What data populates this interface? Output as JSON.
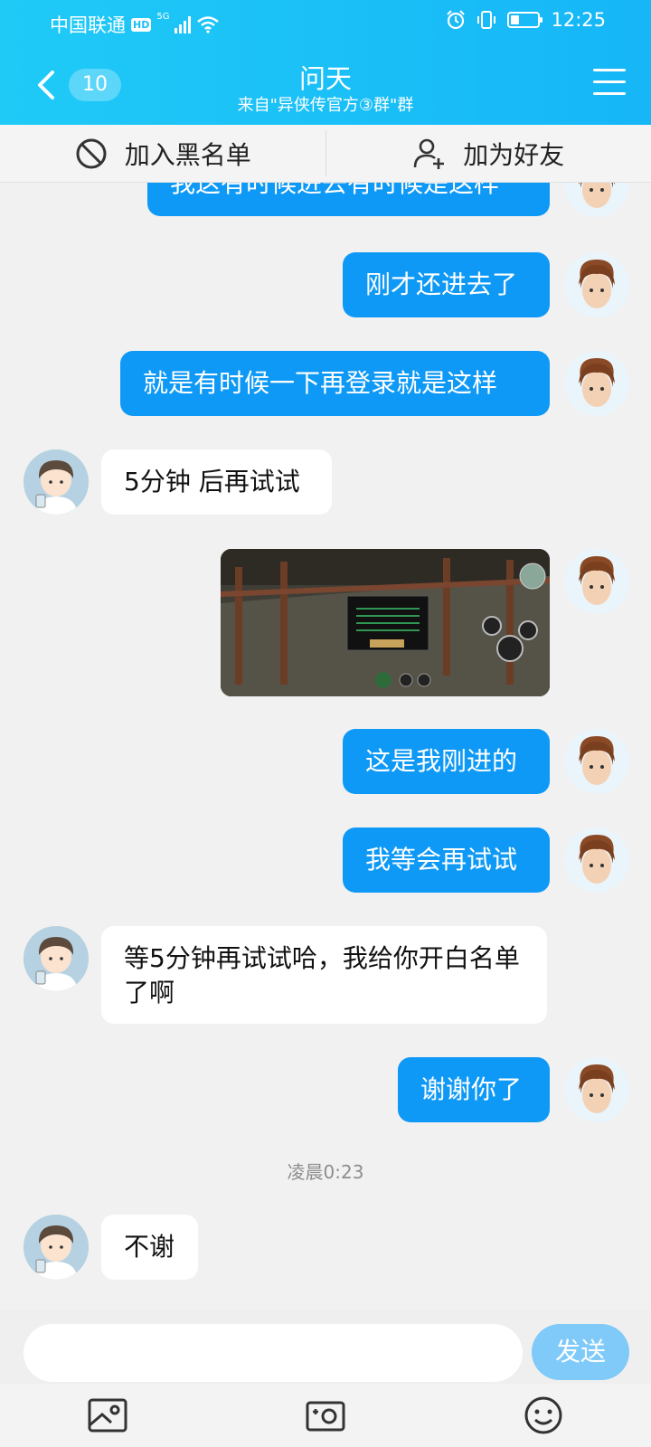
{
  "status_bar": {
    "carrier": "中国联通",
    "hd": "HD",
    "network": "5G",
    "time": "12:25"
  },
  "header": {
    "unread_count": "10",
    "title": "问天",
    "subtitle": "来自\"异侠传官方③群\"群"
  },
  "actions": {
    "blacklist_label": "加入黑名单",
    "add_friend_label": "加为好友"
  },
  "messages": [
    {
      "side": "right",
      "text": "我这有时候进去有时候是这样"
    },
    {
      "side": "right",
      "text": "刚才还进去了"
    },
    {
      "side": "right",
      "text": "就是有时候一下再登录就是这样"
    },
    {
      "side": "left",
      "text": "5分钟 后再试试"
    },
    {
      "side": "right",
      "type": "image"
    },
    {
      "side": "right",
      "text": "这是我刚进的"
    },
    {
      "side": "right",
      "text": "我等会再试试"
    },
    {
      "side": "left",
      "text": "等5分钟再试试哈，我给你开白名单了啊"
    },
    {
      "side": "right",
      "text": "谢谢你了"
    },
    {
      "side": "left",
      "text": "不谢"
    }
  ],
  "timestamp": "凌晨0:23",
  "composer": {
    "send_label": "发送"
  },
  "toolbar_icons": [
    "image-icon",
    "camera-icon",
    "emoji-icon"
  ],
  "colors": {
    "header_blue": "#16b6f7",
    "bubble_blue": "#0f99f6",
    "send_disabled": "#7fcaf8"
  }
}
